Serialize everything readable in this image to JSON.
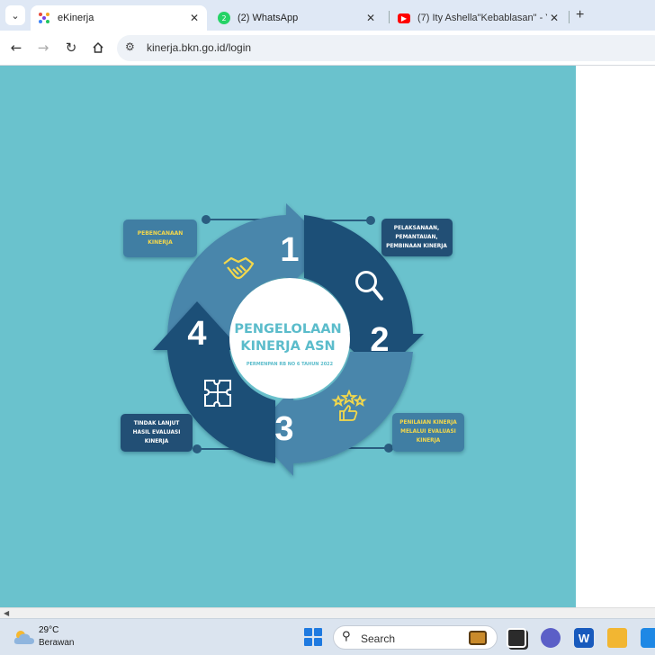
{
  "browser": {
    "tabs": [
      {
        "title": "eKinerja",
        "active": true
      },
      {
        "title": "(2) WhatsApp",
        "active": false
      },
      {
        "title": "(7) Ity Ashella\"Kebablasan\" - Yo",
        "active": false
      }
    ],
    "address": "kinerja.bkn.go.id/login"
  },
  "diagram": {
    "center_title_line1": "PENGELOLAAN",
    "center_title_line2": "KINERJA ASN",
    "center_subtitle": "PERMENPAN RB NO 6 TAHUN 2022",
    "steps": [
      {
        "number": "1",
        "label_lines": [
          "PEBENCANAAN",
          "KINERJA"
        ],
        "icon": "handshake-icon"
      },
      {
        "number": "2",
        "label_lines": [
          "PELAKSANAAN,",
          "PEMANTAUAN,",
          "PEMBINAAN KINERJA"
        ],
        "icon": "magnifier-icon"
      },
      {
        "number": "3",
        "label_lines": [
          "PENILAIAN KINERJA",
          "MELALUI EVALUASI",
          "KINERJA"
        ],
        "icon": "thumbs-up-stars-icon"
      },
      {
        "number": "4",
        "label_lines": [
          "TINDAK LANJUT",
          "HASIL EVALUASI",
          "KINERJA"
        ],
        "icon": "puzzle-icon"
      }
    ],
    "colors": {
      "background": "#6ac2cd",
      "arrow_light": "#3f7ea3",
      "arrow_dark": "#1e4c73",
      "label_box": "#215074",
      "label_text_yellow": "#f4d84b",
      "center_text": "#5bbccb"
    }
  },
  "taskbar": {
    "weather_temp": "29°C",
    "weather_desc": "Berawan",
    "search_placeholder": "Search"
  }
}
